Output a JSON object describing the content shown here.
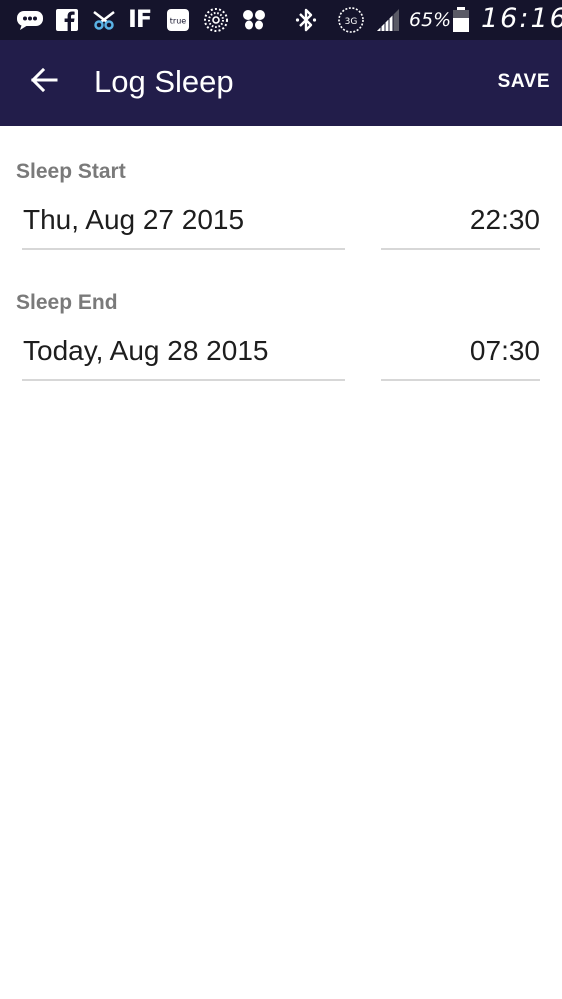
{
  "status_bar": {
    "icons": [
      "chat-icon",
      "facebook-icon",
      "scissors-icon",
      "ifttt-icon",
      "true-app-icon",
      "sunburst-icon",
      "butterfly-icon",
      "bluetooth-icon",
      "network-3g-icon",
      "signal-icon",
      "battery-icon"
    ],
    "ifttt_label": "IF",
    "true_label": "true",
    "network_label": "3G",
    "battery": "65%",
    "time": "16:16"
  },
  "app_bar": {
    "title": "Log Sleep",
    "save_label": "SAVE",
    "back_icon": "arrow-left-icon"
  },
  "sleep_start": {
    "label": "Sleep Start",
    "date": "Thu, Aug 27 2015",
    "time": "22:30"
  },
  "sleep_end": {
    "label": "Sleep End",
    "date": "Today, Aug 28 2015",
    "time": "07:30"
  },
  "colors": {
    "status_bar_bg": "#15142c",
    "app_bar_bg": "#221d4a",
    "label_gray": "#7a7a7a",
    "divider": "#d7d7d7"
  }
}
